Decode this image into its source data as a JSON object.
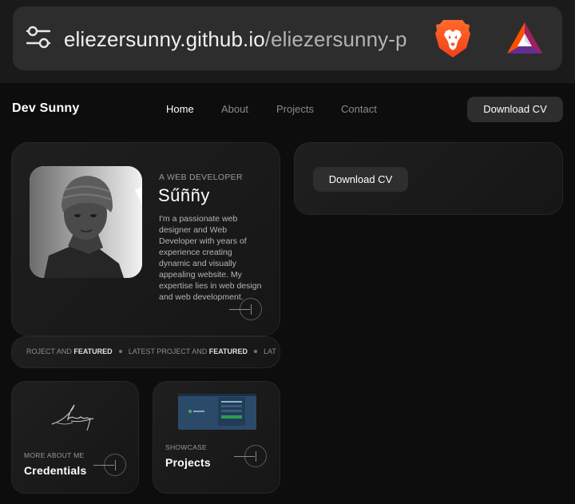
{
  "browser": {
    "url_host": "eliezersunny.github.io",
    "url_path": "/eliezersunny-p",
    "icons": [
      "tune-icon",
      "brave-lion-icon",
      "bat-triangle-icon"
    ]
  },
  "site": {
    "logo": "Dev Sunny",
    "nav": [
      {
        "label": "Home",
        "active": true
      },
      {
        "label": "About",
        "active": false
      },
      {
        "label": "Projects",
        "active": false
      },
      {
        "label": "Contact",
        "active": false
      }
    ],
    "download_cv_label": "Download CV"
  },
  "profile": {
    "eyebrow": "A WEB DEVELOPER",
    "name": "Sűññy",
    "bio": "I'm a passionate web designer and Web Developer with years of experience creating dynamic and visually appealing website. My expertise lies in web design and web development."
  },
  "cv_card": {
    "button_label": "Download CV"
  },
  "ticker": {
    "items": [
      {
        "plain": "ROJECT AND ",
        "bold": "FEATURED"
      },
      {
        "plain": "LATEST PROJECT AND ",
        "bold": "FEATURED"
      },
      {
        "plain": "LAT",
        "bold": ""
      }
    ]
  },
  "credentials_card": {
    "eyebrow": "MORE ABOUT ME",
    "title": "Credentials"
  },
  "projects_card": {
    "eyebrow": "SHOWCASE",
    "title": "Projects"
  },
  "colors": {
    "background": "#0d0d0d",
    "card": "#1c1c1c",
    "button": "#2e2e2e",
    "brave_orange": "#fb542b",
    "bat_purple": "#662d91"
  }
}
